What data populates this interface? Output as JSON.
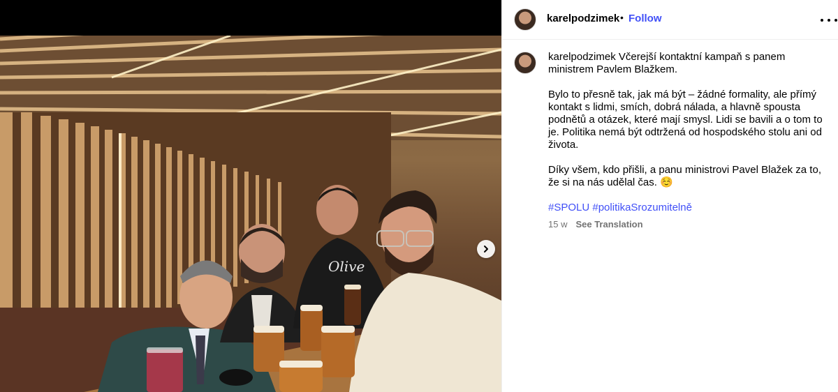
{
  "post": {
    "username": "karelpodzimek",
    "separator": "•",
    "follow_label": "Follow",
    "more_icon": "more-horizontal-icon",
    "caption": {
      "username": "karelpodzimek",
      "line1": "Včerejší kontaktní kampaň s panem ministrem Pavlem Blažkem.",
      "paragraph2": "Bylo to přesně tak, jak má být – žádné formality, ale přímý kontakt s lidmi, smích, dobrá nálada, a hlavně spousta podnětů a otázek, které mají smysl. Lidi se bavili a o tom to je. Politika nemá být odtržená od hospodského stolu ani od života.",
      "paragraph3": "Díky všem, kdo přišli, a panu ministrovi Pavel Blažek za to, že si na nás udělal čas. ☺️",
      "hashtags": [
        "#SPOLU",
        "#politikaSrozumitelně"
      ]
    },
    "age": "15 w",
    "translate_label": "See Translation"
  },
  "media": {
    "next_icon": "chevron-right-icon"
  },
  "colors": {
    "link": "#4150f7",
    "secondary_text": "#737373",
    "divider": "#efefef"
  }
}
